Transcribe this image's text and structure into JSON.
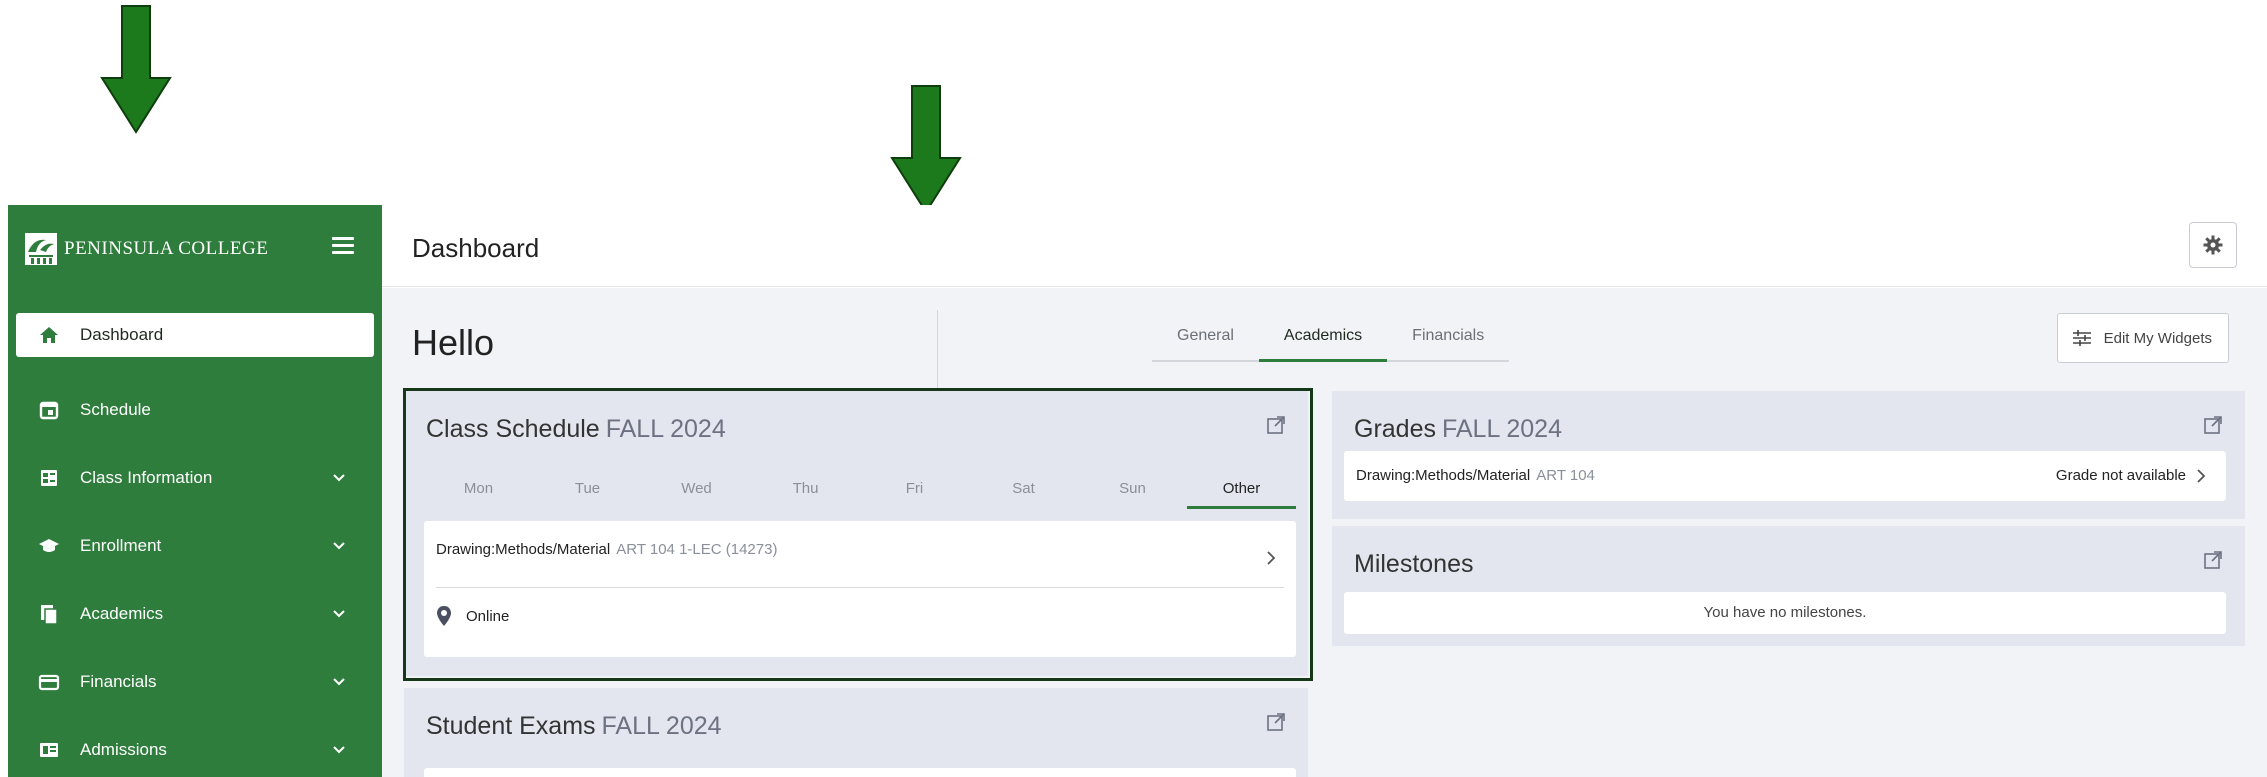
{
  "sidebar": {
    "brand_name": "PENINSULA COLLEGE",
    "items": [
      {
        "label": "Dashboard",
        "icon": "home-icon",
        "active": true,
        "expandable": false
      },
      {
        "label": "Schedule",
        "icon": "calendar-icon",
        "active": false,
        "expandable": false
      },
      {
        "label": "Class Information",
        "icon": "class-info-icon",
        "active": false,
        "expandable": true
      },
      {
        "label": "Enrollment",
        "icon": "graduation-cap-icon",
        "active": false,
        "expandable": true
      },
      {
        "label": "Academics",
        "icon": "documents-icon",
        "active": false,
        "expandable": true
      },
      {
        "label": "Financials",
        "icon": "credit-card-icon",
        "active": false,
        "expandable": true
      },
      {
        "label": "Admissions",
        "icon": "admissions-icon",
        "active": false,
        "expandable": true
      }
    ]
  },
  "header": {
    "title": "Dashboard"
  },
  "main": {
    "greeting": "Hello",
    "tabs": [
      {
        "label": "General",
        "active": false
      },
      {
        "label": "Academics",
        "active": true
      },
      {
        "label": "Financials",
        "active": false
      }
    ],
    "edit_widgets_label": "Edit My Widgets"
  },
  "class_schedule": {
    "title": "Class Schedule",
    "term": "FALL 2024",
    "days": [
      "Mon",
      "Tue",
      "Wed",
      "Thu",
      "Fri",
      "Sat",
      "Sun",
      "Other"
    ],
    "active_day": "Other",
    "course_name": "Drawing:Methods/Material",
    "course_code": "ART 104 1-LEC (14273)",
    "location": "Online"
  },
  "grades": {
    "title": "Grades",
    "term": "FALL 2024",
    "course_name": "Drawing:Methods/Material",
    "course_code": "ART 104",
    "status": "Grade not available"
  },
  "milestones": {
    "title": "Milestones",
    "empty_text": "You have no milestones."
  },
  "student_exams": {
    "title": "Student Exams",
    "term": "FALL 2024"
  },
  "colors": {
    "brand_green": "#2e7d3d",
    "arrow_green": "#1c7a1c",
    "highlight_border": "#143818",
    "card_bg": "#e3e6ee"
  }
}
